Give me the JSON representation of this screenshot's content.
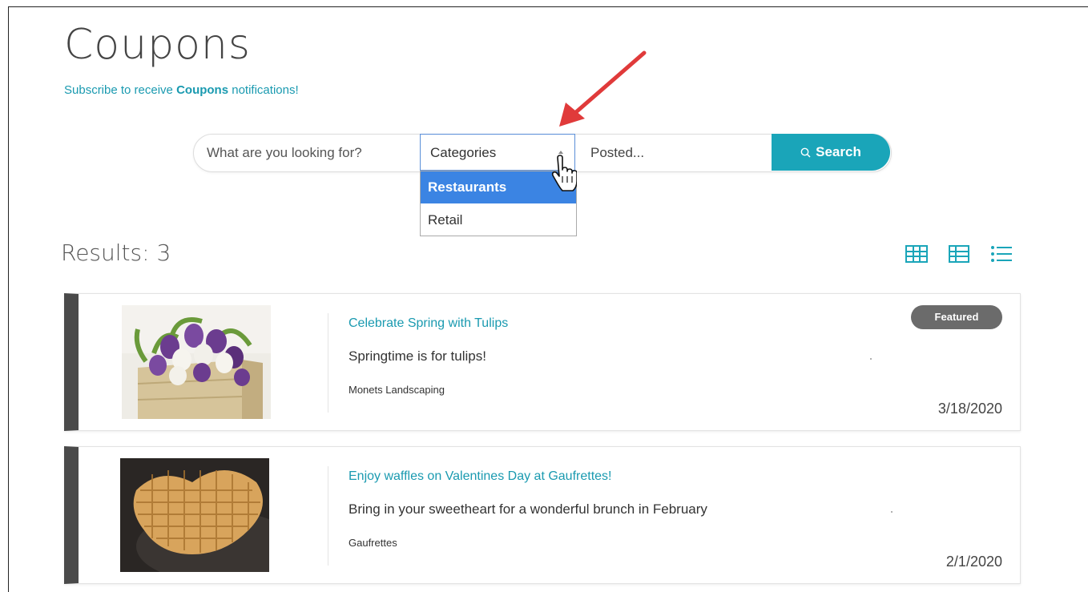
{
  "page": {
    "title": "Coupons",
    "subscribe_prefix": "Subscribe to receive ",
    "subscribe_bold": "Coupons",
    "subscribe_suffix": " notifications!"
  },
  "search": {
    "placeholder": "What are you looking for?",
    "category_label": "Categories",
    "posted_label": "Posted...",
    "button_label": "Search",
    "category_options": [
      "Restaurants",
      "Retail"
    ],
    "highlighted_option": "Restaurants"
  },
  "results": {
    "label": "Results: 3"
  },
  "coupons": [
    {
      "title": "Celebrate Spring with Tulips",
      "description": "Springtime is for tulips!",
      "business": "Monets Landscaping",
      "date": "3/18/2020",
      "badge": "Featured"
    },
    {
      "title": "Enjoy waffles on Valentines Day at Gaufrettes!",
      "description": "Bring in your sweetheart for a wonderful brunch in February",
      "business": "Gaufrettes",
      "date": "2/1/2020",
      "badge": ""
    }
  ],
  "colors": {
    "accent": "#1aa5b9",
    "link": "#1a9ab0",
    "dropdown_highlight": "#3b84e3",
    "card_bar": "#4a4a4a",
    "badge": "#6b6b6b",
    "annotation_arrow": "#e03a3a"
  },
  "icons": {
    "search": "search-icon",
    "grid_view": "grid-view-icon",
    "table_view": "table-view-icon",
    "list_view": "list-view-icon"
  }
}
